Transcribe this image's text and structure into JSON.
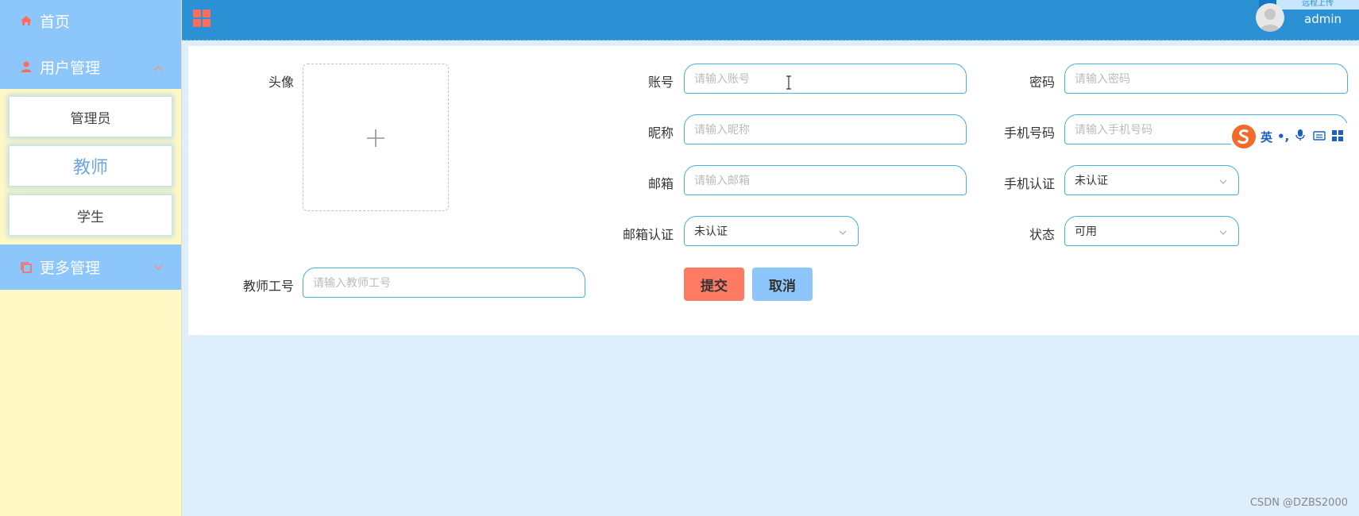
{
  "sidebar": {
    "home_label": "首页",
    "users_label": "用户管理",
    "sub_items": [
      "管理员",
      "教师",
      "学生"
    ],
    "more_label": "更多管理"
  },
  "header": {
    "username": "admin",
    "corner_text": "远程上传"
  },
  "form": {
    "avatar_label": "头像",
    "account_label": "账号",
    "account_placeholder": "请输入账号",
    "password_label": "密码",
    "password_placeholder": "请输入密码",
    "nickname_label": "昵称",
    "nickname_placeholder": "请输入昵称",
    "phone_label": "手机号码",
    "phone_placeholder": "请输入手机号码",
    "email_label": "邮箱",
    "email_placeholder": "请输入邮箱",
    "phone_verify_label": "手机认证",
    "phone_verify_value": "未认证",
    "email_verify_label": "邮箱认证",
    "email_verify_value": "未认证",
    "status_label": "状态",
    "status_value": "可用",
    "teacher_no_label": "教师工号",
    "teacher_no_placeholder": "请输入教师工号",
    "submit_label": "提交",
    "cancel_label": "取消"
  },
  "ime": {
    "mode": "英",
    "punct": "•,"
  },
  "watermark": "CSDN @DZBS2000",
  "colors": {
    "sidebar_bg": "#fff9c6",
    "menu_blue": "#8cc6fb",
    "topbar": "#2b91d4",
    "submit": "#ff7a63",
    "cancel": "#8cc6fb",
    "accent_icon": "#ff6d5a"
  }
}
